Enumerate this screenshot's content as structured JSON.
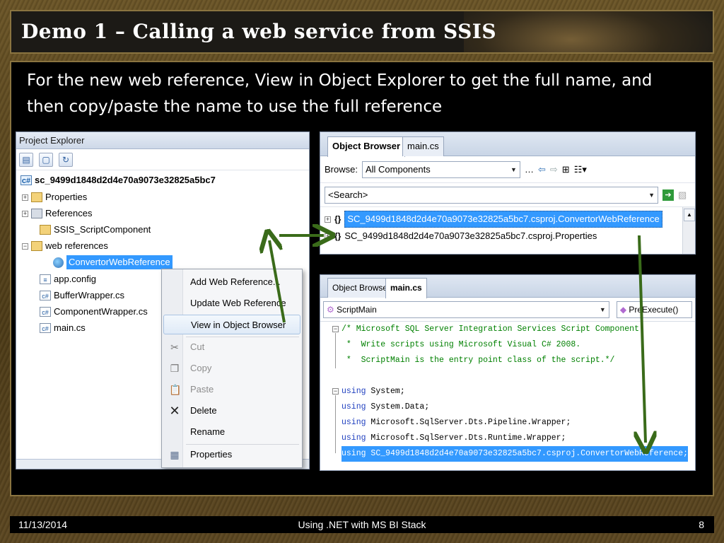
{
  "slide": {
    "title": "Demo 1 – Calling a web service from SSIS",
    "intro": "For the new web reference, View in Object Explorer to get the full name, and then copy/paste the name to use the full reference"
  },
  "project_explorer": {
    "title": "Project Explorer",
    "project_name": "sc_9499d1848d2d4e70a9073e32825a5bc7",
    "items": [
      {
        "label": "Properties"
      },
      {
        "label": "References"
      },
      {
        "label": "SSIS_ScriptComponent"
      },
      {
        "label": "web references"
      },
      {
        "label": "ConvertorWebReference"
      },
      {
        "label": "app.config"
      },
      {
        "label": "BufferWrapper.cs"
      },
      {
        "label": "ComponentWrapper.cs"
      },
      {
        "label": "main.cs"
      }
    ]
  },
  "context_menu": {
    "items": [
      {
        "label": "Add Web Reference..."
      },
      {
        "label": "Update Web Reference"
      },
      {
        "label": "View in Object Browser"
      },
      {
        "label": "Cut"
      },
      {
        "label": "Copy"
      },
      {
        "label": "Paste"
      },
      {
        "label": "Delete"
      },
      {
        "label": "Rename"
      },
      {
        "label": "Properties"
      }
    ]
  },
  "object_browser": {
    "tabs": [
      "Object Browser",
      "main.cs"
    ],
    "browse_label": "Browse:",
    "browse_value": "All Components",
    "search_value": "<Search>",
    "rows": [
      {
        "label": "SC_9499d1848d2d4e70a9073e32825a5bc7.csproj.ConvertorWebReference"
      },
      {
        "label": "SC_9499d1848d2d4e70a9073e32825a5bc7.csproj.Properties"
      }
    ]
  },
  "code_editor": {
    "tabs": [
      "Object Browser",
      "main.cs"
    ],
    "class_combo": "ScriptMain",
    "member_combo": "PreExecute()",
    "lines": [
      {
        "kw": "",
        "text": "/* Microsoft SQL Server Integration Services Script Component"
      },
      {
        "kw": "",
        "text": " *  Write scripts using Microsoft Visual C# 2008."
      },
      {
        "kw": "",
        "text": " *  ScriptMain is the entry point class of the script.*/"
      },
      {
        "kw": "using",
        "text": " System;"
      },
      {
        "kw": "using",
        "text": " System.Data;"
      },
      {
        "kw": "using",
        "text": " Microsoft.SqlServer.Dts.Pipeline.Wrapper;"
      },
      {
        "kw": "using",
        "text": " Microsoft.SqlServer.Dts.Runtime.Wrapper;"
      },
      {
        "kw": "using",
        "text": " SC_9499d1848d2d4e70a9073e32825a5bc7.csproj.ConvertorWebReference;"
      }
    ]
  },
  "footer": {
    "date": "11/13/2014",
    "center": "Using .NET with MS BI Stack",
    "page": "8"
  },
  "colors": {
    "arrow": "#3a6b1a",
    "selection": "#3399ff",
    "title_text": "#ffffff"
  }
}
